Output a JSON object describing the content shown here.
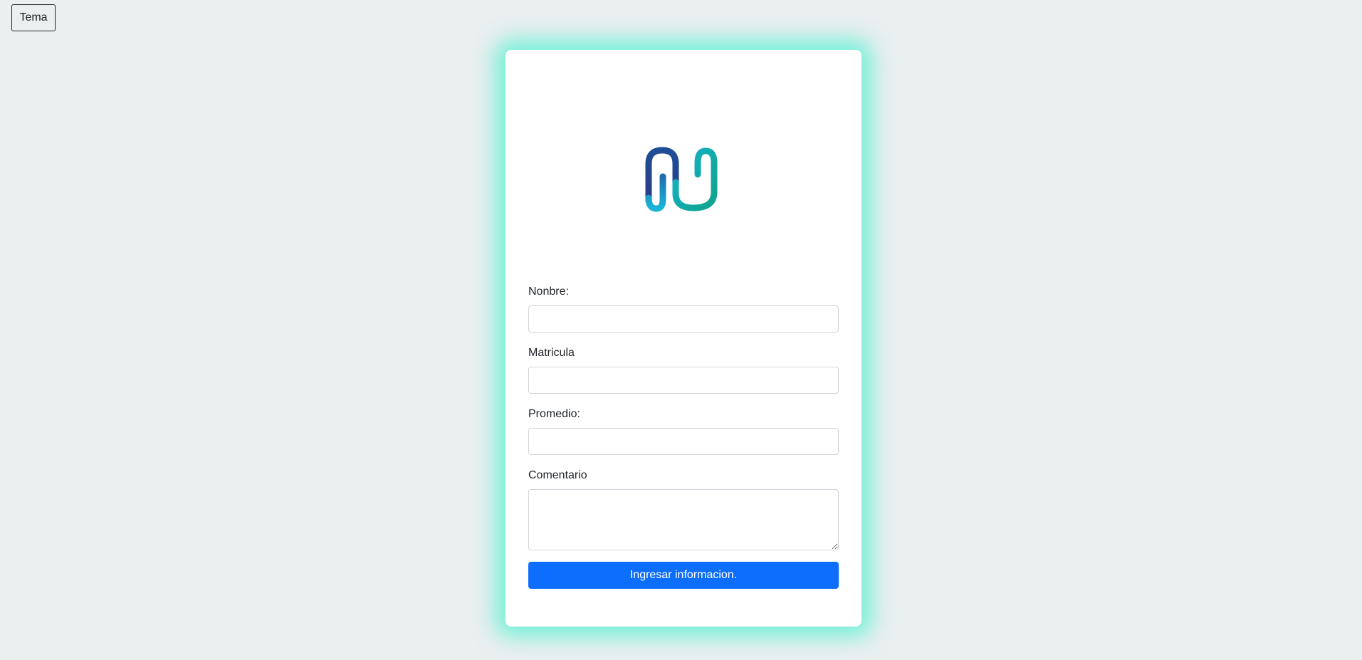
{
  "theme_button": {
    "label": "Tema"
  },
  "logo": {
    "icon": "brand-logo-icon",
    "colors": {
      "dark_blue": "#2b3a8a",
      "cyan": "#1ab6d8",
      "teal": "#12a38a"
    }
  },
  "form": {
    "nombre_label": "Nonbre:",
    "matricula_label": "Matricula",
    "promedio_label": "Promedio:",
    "comentario_label": "Comentario",
    "nombre_value": "",
    "matricula_value": "",
    "promedio_value": "",
    "comentario_value": "",
    "submit_label": "Ingresar informacion."
  },
  "colors": {
    "background": "#eaeff0",
    "card": "#ffffff",
    "card_glow": "#60f0d2",
    "primary": "#0d6efd"
  }
}
